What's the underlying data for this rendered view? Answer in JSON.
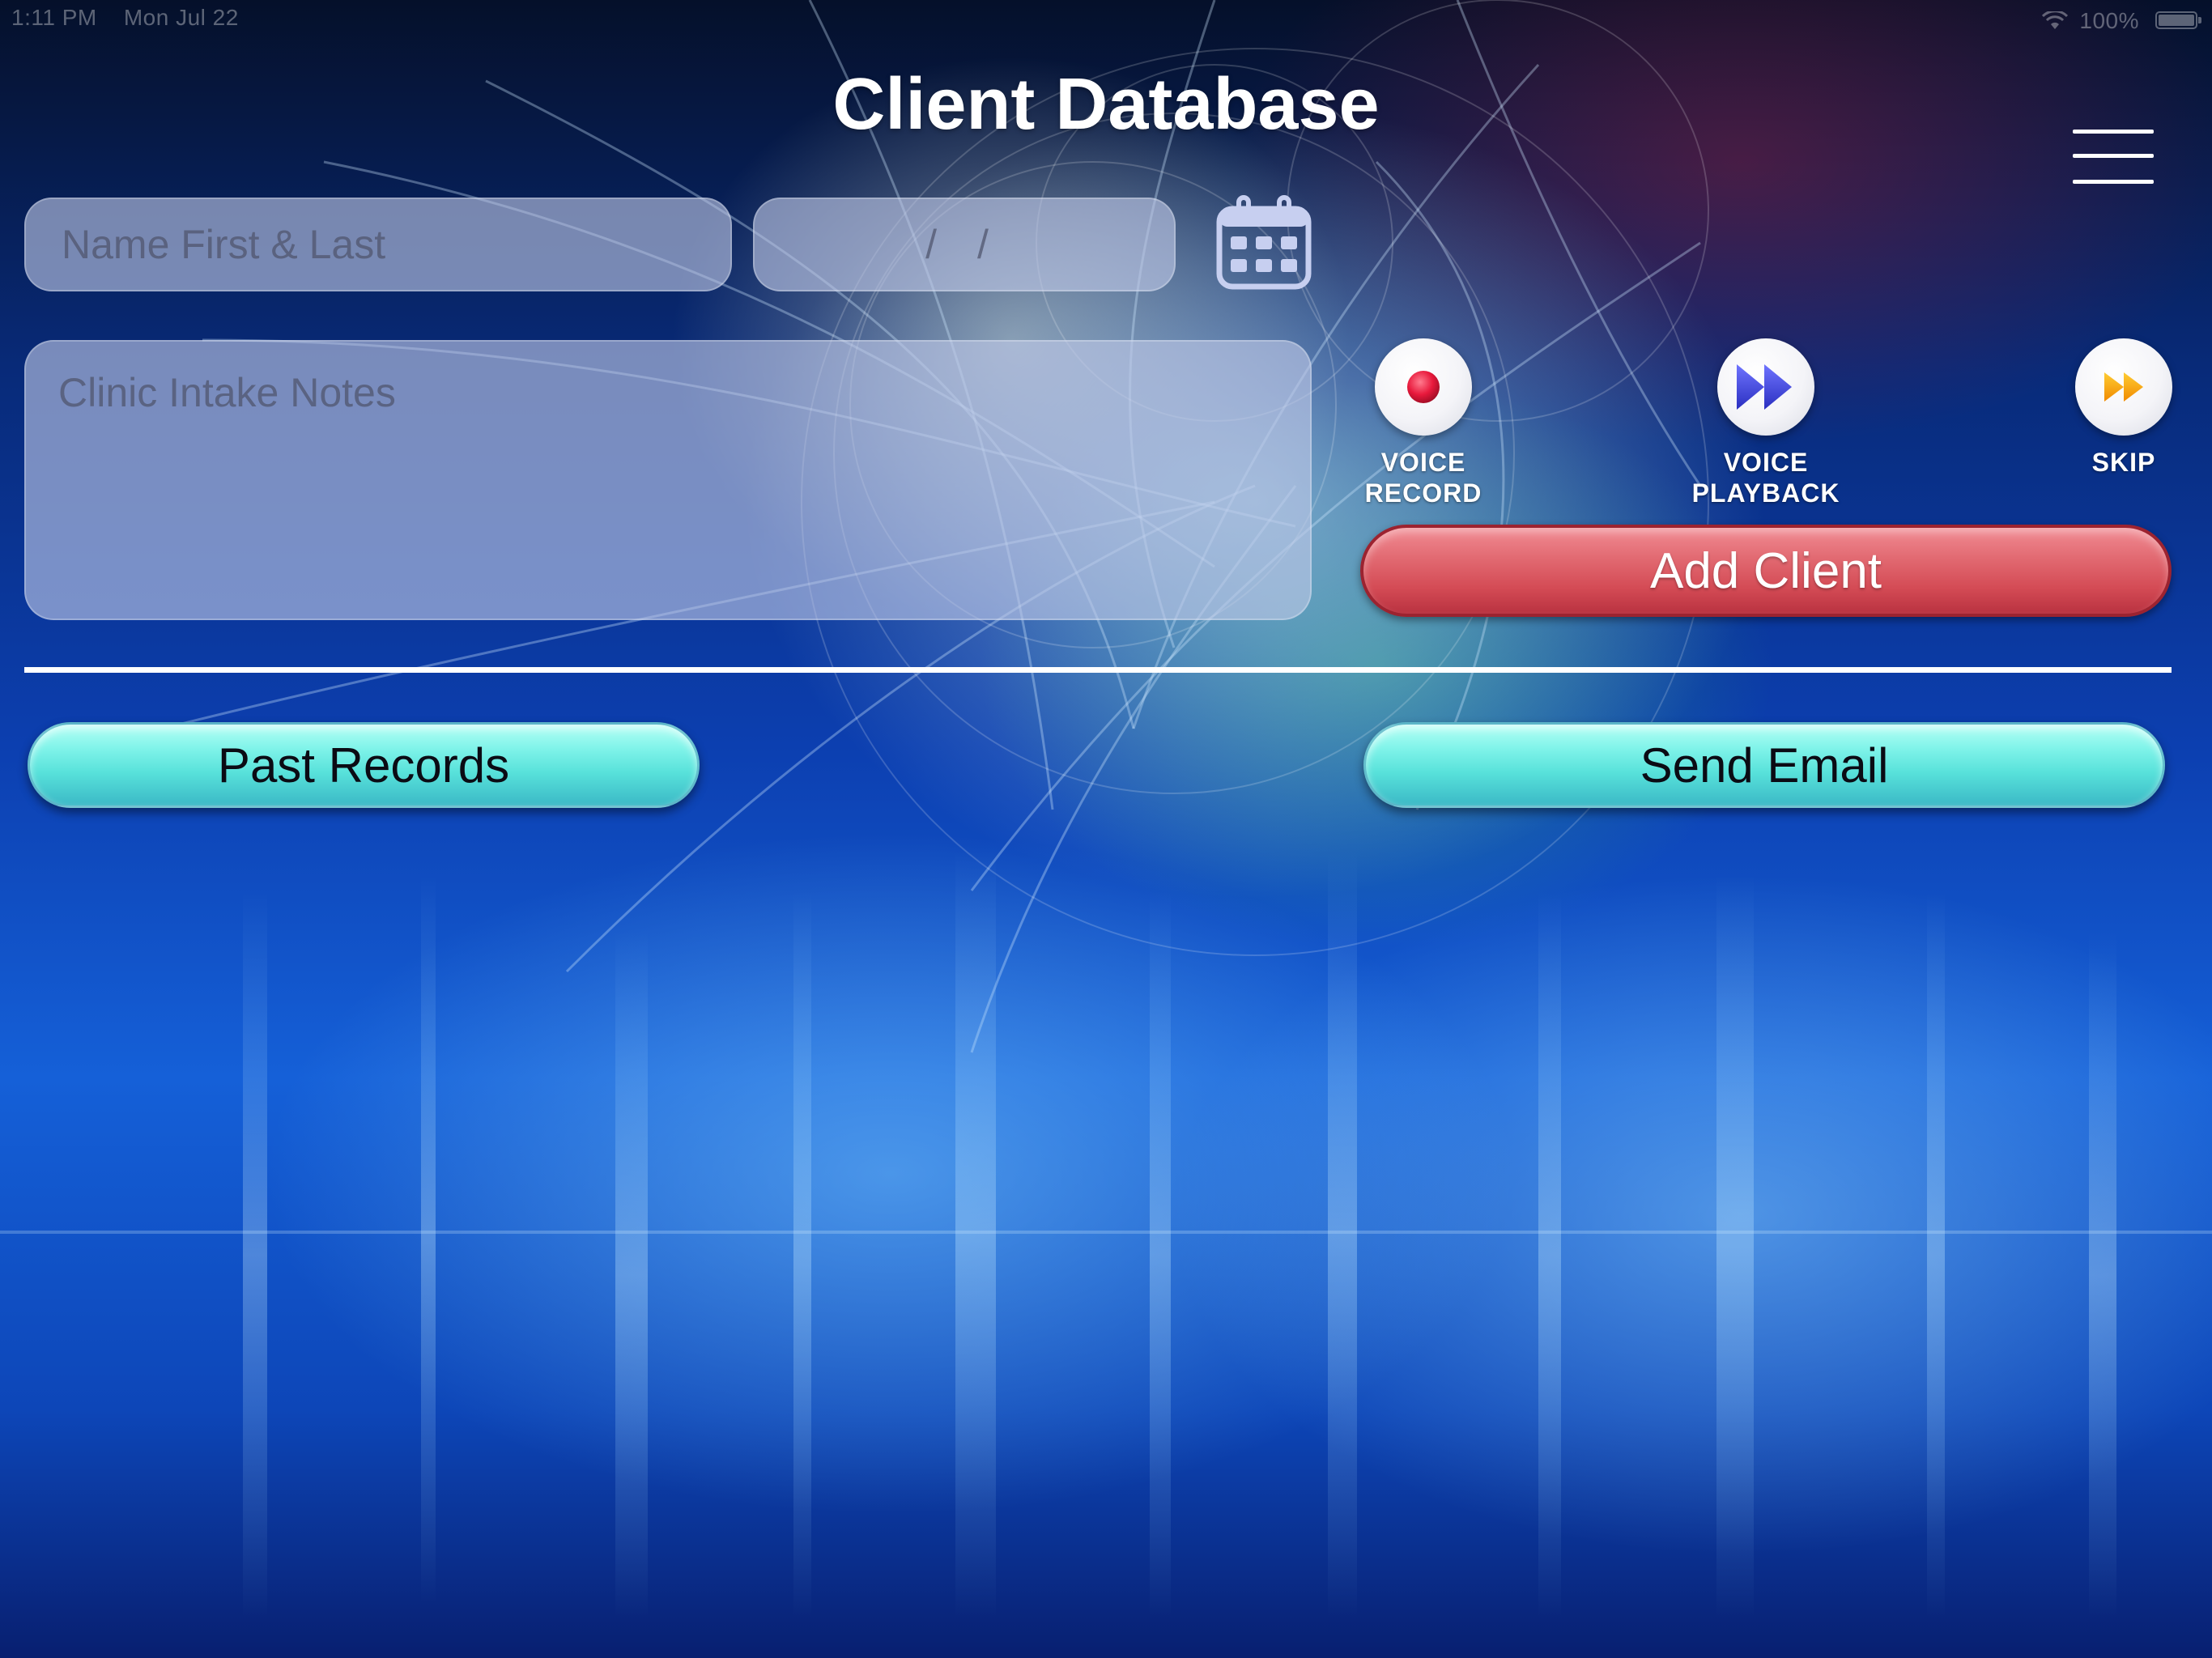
{
  "status_bar": {
    "time": "1:11 PM",
    "date": "Mon Jul 22",
    "battery": "100%",
    "wifi_icon": "wifi-icon",
    "battery_icon": "battery-icon"
  },
  "header": {
    "title": "Client Database",
    "menu_icon": "hamburger-menu-icon"
  },
  "form": {
    "name_placeholder": "Name First & Last",
    "name_value": "",
    "date_placeholder": "/ /",
    "date_value": "",
    "calendar_icon": "calendar-icon",
    "notes_placeholder": "Clinic Intake Notes",
    "notes_value": ""
  },
  "controls": {
    "record": {
      "label": "VOICE\nRECORD",
      "icon": "record-icon",
      "color": "#e8193c"
    },
    "playback": {
      "label": "VOICE\nPLAYBACK",
      "icon": "fast-forward-icon",
      "color": "#3a3fd8"
    },
    "skip": {
      "label": "SKIP",
      "icon": "skip-icon",
      "color": "#f5a300"
    }
  },
  "actions": {
    "add_client": "Add Client",
    "past_records": "Past Records",
    "send_email": "Send Email"
  },
  "colors": {
    "add_client_red": "#d44b55",
    "pill_cyan": "#57e1da",
    "title_white": "#ffffff"
  }
}
